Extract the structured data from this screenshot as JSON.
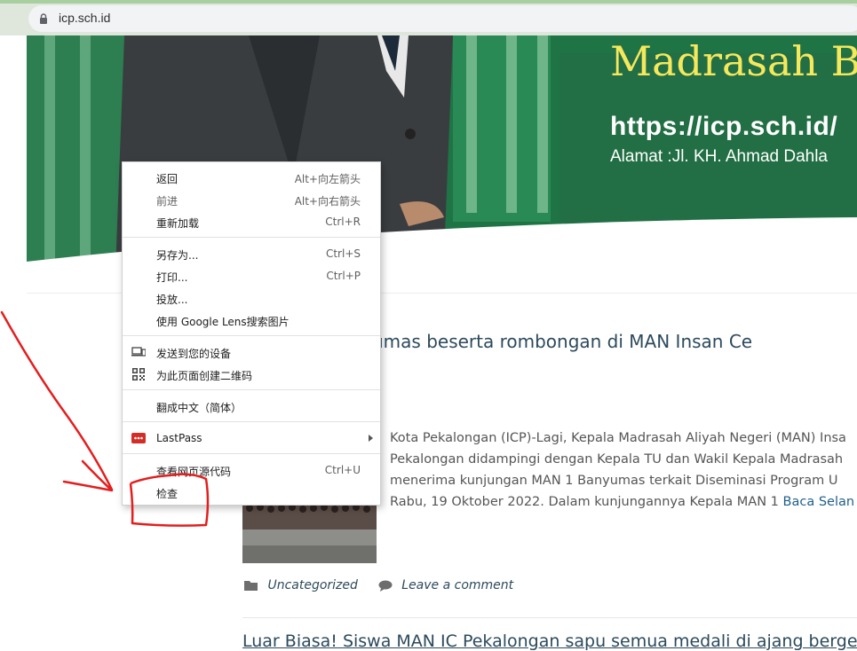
{
  "browser": {
    "url": "icp.sch.id"
  },
  "banner": {
    "title": "Madrasah B",
    "url": "https://icp.sch.id/",
    "address": "Alamat :Jl. KH. Ahmad Dahla"
  },
  "article": {
    "title": "la MAN 1 Banyumas beserta rombongan di MAN Insan Ce",
    "excerpt_lines": [
      "Kota Pekalongan (ICP)-Lagi, Kepala Madrasah Aliyah Negeri (MAN) Insa",
      "Pekalongan didampingi dengan Kepala TU dan Wakil Kepala Madrasah",
      "menerima kunjungan MAN 1 Banyumas terkait Diseminasi Program U",
      "Rabu, 19 Oktober 2022. Dalam kunjungannya Kepala MAN 1 "
    ],
    "read_more": "Baca Selan",
    "category": "Uncategorized",
    "comment": "Leave a comment",
    "next_title": "Luar Biasa! Siswa MAN IC Pekalongan sapu semua medali di ajang bergeng"
  },
  "context_menu": {
    "back": {
      "label": "返回",
      "shortcut": "Alt+向左箭头"
    },
    "forward": {
      "label": "前进",
      "shortcut": "Alt+向右箭头"
    },
    "reload": {
      "label": "重新加载",
      "shortcut": "Ctrl+R"
    },
    "save_as": {
      "label": "另存为...",
      "shortcut": "Ctrl+S"
    },
    "print": {
      "label": "打印...",
      "shortcut": "Ctrl+P"
    },
    "cast": {
      "label": "投放..."
    },
    "lens": {
      "label": "使用 Google Lens搜索图片"
    },
    "send_device": {
      "label": "发送到您的设备"
    },
    "qr_code": {
      "label": "为此页面创建二维码"
    },
    "translate": {
      "label": "翻成中文（简体）"
    },
    "lastpass": {
      "label": "LastPass"
    },
    "view_source": {
      "label": "查看网页源代码",
      "shortcut": "Ctrl+U"
    },
    "inspect": {
      "label": "检查"
    }
  },
  "colors": {
    "banner_green": "#20784a",
    "banner_title": "#f6e85c",
    "annotation_red": "#e41e1e",
    "lastpass_red": "#d32d27"
  }
}
